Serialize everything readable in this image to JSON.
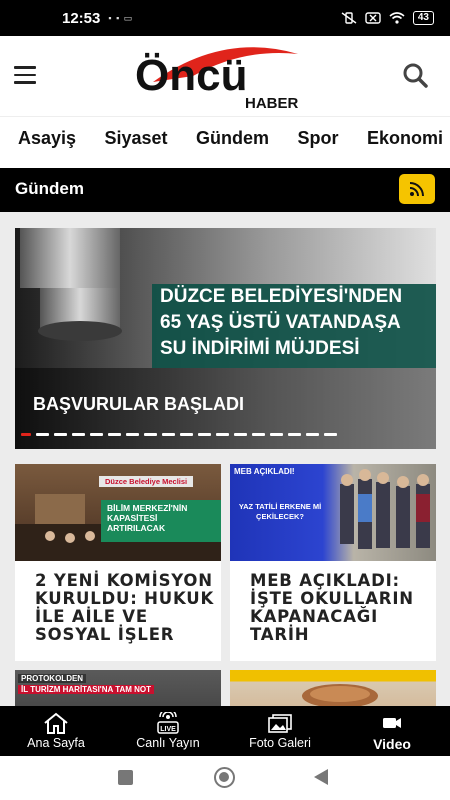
{
  "status_bar": {
    "time": "12:53",
    "left_icons": "▪ ▪ ▭",
    "battery": "43"
  },
  "header": {
    "logo_main": "Öncü",
    "logo_sub": "HABER"
  },
  "categories": [
    "Asayiş",
    "Siyaset",
    "Gündem",
    "Spor",
    "Ekonomi"
  ],
  "section": {
    "title": "Gündem",
    "rss_icon": "rss-icon"
  },
  "slider": {
    "banner_lines": [
      "DÜZCE BELEDİYESİ'NDEN",
      "65 YAŞ ÜSTÜ VATANDAŞA",
      "SU İNDİRİMİ MÜJDESİ"
    ],
    "caption": "BAŞVURULAR BAŞLADI",
    "dot_count": 18,
    "active_dot": 0
  },
  "cards": [
    {
      "title": "2 YENİ KOMİSYON KURULDU: HUKUK İLE AİLE VE SOSYAL İŞLER",
      "thumb_label": "Düzce Belediye Meclisi",
      "thumb_text": "BİLİM MERKEZİ'NİN KAPASİTESİ ARTIRILACAK"
    },
    {
      "title": "MEB AÇIKLADI: İŞTE OKULLARIN KAPANACAĞI TARİH",
      "thumb_tag": "MEB AÇIKLADI!",
      "thumb_text": "YAZ TATİLİ ERKENE Mİ ÇEKİLECEK?"
    },
    {
      "title": "",
      "thumb_t1": "PROTOKOLDEN",
      "thumb_t2": "İL TURİZM HARİTASI'NA TAM NOT"
    },
    {
      "title": ""
    }
  ],
  "bottom_nav": [
    {
      "label": "Ana Sayfa",
      "icon": "home-icon"
    },
    {
      "label": "Canlı Yayın",
      "icon": "live-icon"
    },
    {
      "label": "Foto Galeri",
      "icon": "gallery-icon"
    },
    {
      "label": "Video",
      "icon": "video-icon",
      "active": true
    }
  ],
  "colors": {
    "accent_yellow": "#f5c400",
    "brand_red": "#e0241b",
    "banner_green": "#0e5046"
  }
}
